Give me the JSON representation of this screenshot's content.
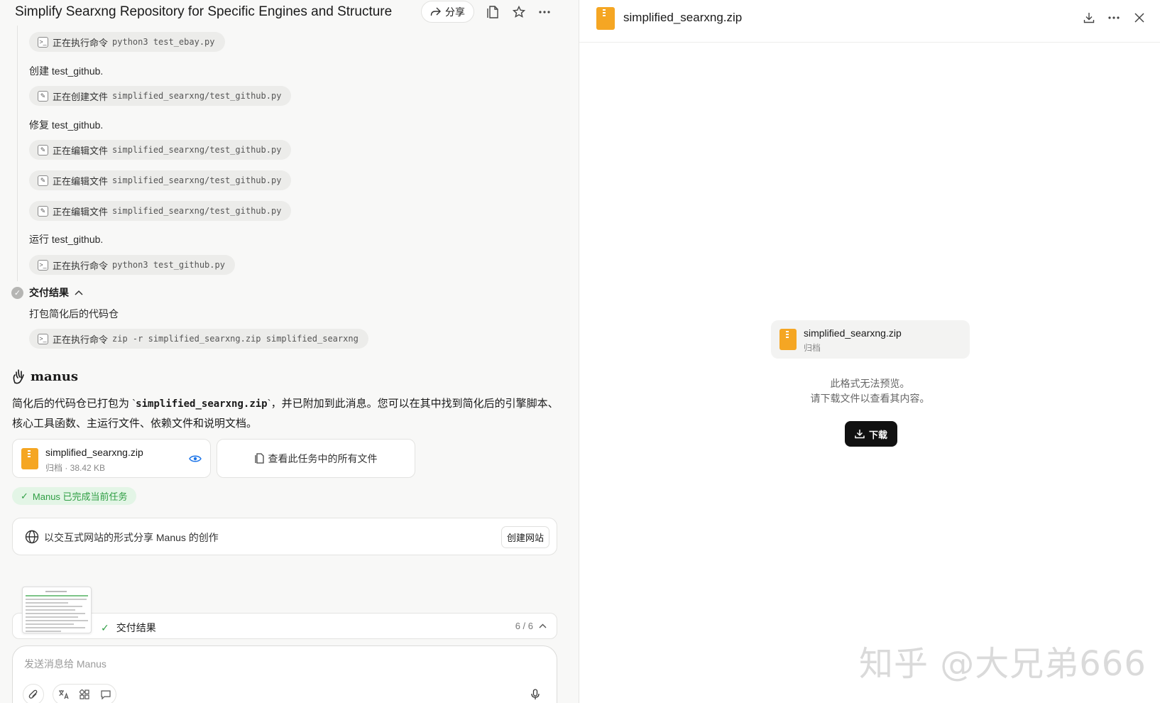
{
  "header": {
    "title": "Simplify Searxng Repository for Specific Engines and Structure",
    "share_label": "分享"
  },
  "steps": [
    {
      "type": "chip",
      "action": "正在执行命令",
      "arg": "python3 test_ebay.py",
      "icon": "terminal-icon"
    },
    {
      "type": "text",
      "text": "创建 test_github."
    },
    {
      "type": "chip",
      "action": "正在创建文件",
      "arg": "simplified_searxng/test_github.py",
      "icon": "edit-icon"
    },
    {
      "type": "text",
      "text": "修复 test_github."
    },
    {
      "type": "chip",
      "action": "正在编辑文件",
      "arg": "simplified_searxng/test_github.py",
      "icon": "edit-icon"
    },
    {
      "type": "chip",
      "action": "正在编辑文件",
      "arg": "simplified_searxng/test_github.py",
      "icon": "edit-icon"
    },
    {
      "type": "chip",
      "action": "正在编辑文件",
      "arg": "simplified_searxng/test_github.py",
      "icon": "edit-icon"
    },
    {
      "type": "text",
      "text": "运行 test_github."
    },
    {
      "type": "chip",
      "action": "正在执行命令",
      "arg": "python3 test_github.py",
      "icon": "terminal-icon"
    }
  ],
  "delivery": {
    "section_title": "交付结果",
    "step_text": "打包简化后的代码仓",
    "chip_action": "正在执行命令",
    "chip_arg": "zip -r simplified_searxng.zip simplified_searxng"
  },
  "message": {
    "brand": "manus",
    "text_before": "简化后的代码仓已打包为 `",
    "code": "simplified_searxng.zip",
    "text_after": "`，并已附加到此消息。您可以在其中找到简化后的引擎脚本、核心工具函数、主运行文件、依赖文件和说明文档。"
  },
  "attachment": {
    "name": "simplified_searxng.zip",
    "meta": "归档 · 38.42 KB"
  },
  "view_all_label": "查看此任务中的所有文件",
  "done_badge": "Manus 已完成当前任务",
  "share_site": {
    "text": "以交互式网站的形式分享 Manus 的创作",
    "button": "创建网站"
  },
  "task_bar": {
    "label": "交付结果",
    "count": "6 / 6"
  },
  "input": {
    "placeholder": "发送消息给 Manus"
  },
  "preview": {
    "title": "simplified_searxng.zip",
    "card_name": "simplified_searxng.zip",
    "card_meta": "归档",
    "line1": "此格式无法预览。",
    "line2": "请下载文件以查看其内容。",
    "download_label": "下载"
  },
  "watermark": "知乎 @大兄弟666",
  "colors": {
    "zip_orange": "#f5a623",
    "success_green": "#2f9e44",
    "success_bg": "#e3f5e6",
    "link_blue": "#1a73e8"
  }
}
